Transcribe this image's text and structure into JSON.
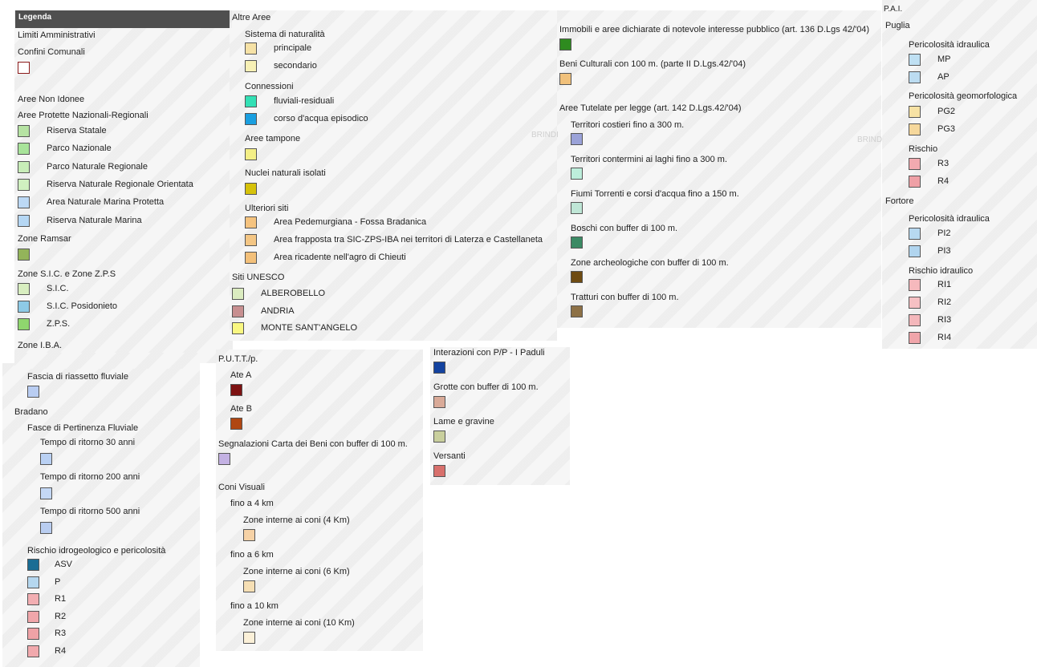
{
  "panel1": {
    "header": "Legenda",
    "limiti": "Limiti Amministrativi",
    "confini": "Confini Comunali",
    "confini_color": "#8b1a1a",
    "aree_non_idonee": "Aree Non Idonee",
    "aree_protette": "Aree Protette Nazionali-Regionali",
    "protette_items": [
      {
        "label": "Riserva Statale",
        "color": "#b6e3a3"
      },
      {
        "label": "Parco Nazionale",
        "color": "#a8e49a"
      },
      {
        "label": "Parco Naturale Regionale",
        "color": "#c8edb8"
      },
      {
        "label": "Riserva Naturale Regionale Orientata",
        "color": "#d0f0c0"
      },
      {
        "label": "Area Naturale Marina Protetta",
        "color": "#bcd9f5"
      },
      {
        "label": "Riserva Naturale Marina",
        "color": "#b5d7f4"
      }
    ],
    "zone_ramsar": "Zone Ramsar",
    "ramsar_color": "#93b45a",
    "zone_sic": "Zone S.I.C. e Zone Z.P.S",
    "sic_items": [
      {
        "label": "S.I.C.",
        "color": "#d8eec0"
      },
      {
        "label": "S.I.C. Posidonieto",
        "color": "#8ecae6"
      },
      {
        "label": "Z.P.S.",
        "color": "#8fd66e"
      }
    ],
    "zone_iba": "Zone I.B.A."
  },
  "panel1b": {
    "fascia": "Fascia di riassetto fluviale",
    "fascia_color": "#b9cdf2",
    "bradano": "Bradano",
    "fasce_pertinenza": "Fasce di Pertinenza Fluviale",
    "tempi": [
      {
        "label": "Tempo di ritorno 30 anni",
        "color": "#b9d0f3"
      },
      {
        "label": "Tempo di ritorno 200 anni",
        "color": "#c4d8f5"
      },
      {
        "label": "Tempo di ritorno 500 anni",
        "color": "#b9cdf0"
      }
    ],
    "rischio": "Rischio idrogeologico e pericolosità",
    "rischio_items": [
      {
        "label": "ASV",
        "color": "#1a6d94"
      },
      {
        "label": "P",
        "color": "#b5d7ef"
      },
      {
        "label": "R1",
        "color": "#f2aeb2"
      },
      {
        "label": "R2",
        "color": "#f0a6aa"
      },
      {
        "label": "R3",
        "color": "#efa2a6"
      },
      {
        "label": "R4",
        "color": "#f1a9ad"
      }
    ]
  },
  "panel2": {
    "altre_aree": "Altre Aree",
    "sistema": "Sistema di naturalità",
    "sistema_items": [
      {
        "label": "principale",
        "color": "#f6e2a6"
      },
      {
        "label": "secondario",
        "color": "#f7f0b5"
      }
    ],
    "connessioni": "Connessioni",
    "conn_items": [
      {
        "label": "fluviali-residuali",
        "color": "#33e0b5"
      },
      {
        "label": "corso d'acqua episodico",
        "color": "#1a9fe0"
      }
    ],
    "aree_tampone": "Aree tampone",
    "tampone_color": "#f4ef86",
    "nuclei": "Nuclei naturali isolati",
    "nuclei_color": "#d6c20a",
    "ulteriori": "Ulteriori siti",
    "ulteriori_items": [
      {
        "label": "Area Pedemurgiana - Fossa Bradanica",
        "color": "#f5c37f"
      },
      {
        "label": "Area frapposta tra SIC-ZPS-IBA nei territori di Laterza e Castellaneta",
        "color": "#f4c684"
      },
      {
        "label": "Area ricadente nell'agro di Chieuti",
        "color": "#f3c07a"
      }
    ],
    "unesco": "Siti UNESCO",
    "unesco_items": [
      {
        "label": "ALBEROBELLO",
        "color": "#dbecc0"
      },
      {
        "label": "ANDRIA",
        "color": "#c78f90"
      },
      {
        "label": "MONTE SANT'ANGELO",
        "color": "#f9f781"
      }
    ]
  },
  "panel3": {
    "immobili": "Immobili e aree dichiarate di notevole interesse pubblico (art. 136 D.Lgs 42/'04)",
    "immobili_color": "#2e8b1f",
    "beni": "Beni Culturali con 100 m. (parte II D.Lgs.42/'04)",
    "beni_color": "#f1c17b",
    "tutelate": "Aree Tutelate per legge (art. 142 D.Lgs.42/'04)",
    "tutelate_items": [
      {
        "label": "Territori costieri fino a 300 m.",
        "color": "#9aa2d8"
      },
      {
        "label": "Territori contermini ai laghi fino a 300 m.",
        "color": "#bdeedb"
      },
      {
        "label": "Fiumi Torrenti e corsi d'acqua fino a 150 m.",
        "color": "#bfe6d6"
      },
      {
        "label": "Boschi con buffer di 100 m.",
        "color": "#3b8a64"
      },
      {
        "label": "Zone archeologiche con buffer di 100 m.",
        "color": "#6e4b12"
      },
      {
        "label": "Tratturi con buffer di 100 m.",
        "color": "#8d7146"
      }
    ],
    "map_labels": [
      "BRINDI",
      "BRINDI"
    ]
  },
  "panel4": {
    "pai": "P.A.I.",
    "puglia": "Puglia",
    "per_idraulica": "Pericolosità idraulica",
    "per_idraulica_items": [
      {
        "label": "MP",
        "color": "#bfe0f3"
      },
      {
        "label": "AP",
        "color": "#bcdcf1"
      }
    ],
    "per_geo": "Pericolosità geomorfologica",
    "per_geo_items": [
      {
        "label": "PG2",
        "color": "#f7e2a4"
      },
      {
        "label": "PG3",
        "color": "#f6d89c"
      }
    ],
    "rischio": "Rischio",
    "rischio_items": [
      {
        "label": "R3",
        "color": "#f2aab0"
      },
      {
        "label": "R4",
        "color": "#efa0a6"
      }
    ],
    "fortore": "Fortore",
    "fortore_idraulica": "Pericolosità idraulica",
    "fortore_idraulica_items": [
      {
        "label": "PI2",
        "color": "#b7d9f0"
      },
      {
        "label": "PI3",
        "color": "#b1d5ef"
      }
    ],
    "rischio_idraulico": "Rischio idraulico",
    "rischio_idraulico_items": [
      {
        "label": "RI1",
        "color": "#f6b9bd"
      },
      {
        "label": "RI2",
        "color": "#f6c0c3"
      },
      {
        "label": "RI3",
        "color": "#f4b7bb"
      },
      {
        "label": "RI4",
        "color": "#f0a5aa"
      }
    ]
  },
  "panel5": {
    "putt": "P.U.T.T./p.",
    "ate_a": "Ate A",
    "ate_a_color": "#7d1212",
    "ate_b": "Ate B",
    "ate_b_color": "#b04712",
    "segnalazioni": "Segnalazioni Carta dei Beni con buffer di 100 m.",
    "segnalazioni_color": "#c3b1e3",
    "coni": "Coni Visuali",
    "coni_items": [
      {
        "group": "fino a 4 km",
        "label": "Zone interne ai coni (4 Km)",
        "color": "#f6d2a6"
      },
      {
        "group": "fino a 6 km",
        "label": "Zone interne ai coni (6 Km)",
        "color": "#f6dfb4"
      },
      {
        "group": "fino a 10 km",
        "label": "Zone interne ai coni (10 Km)",
        "color": "#fbf0d8"
      }
    ]
  },
  "panel6": {
    "interazioni": "Interazioni con P/P - I Paduli",
    "interazioni_color": "#1443a0",
    "grotte": "Grotte con buffer di 100 m.",
    "grotte_color": "#d9aa98",
    "lame": "Lame e gravine",
    "lame_color": "#c9cf9d",
    "versanti": "Versanti",
    "versanti_color": "#d8706c"
  }
}
